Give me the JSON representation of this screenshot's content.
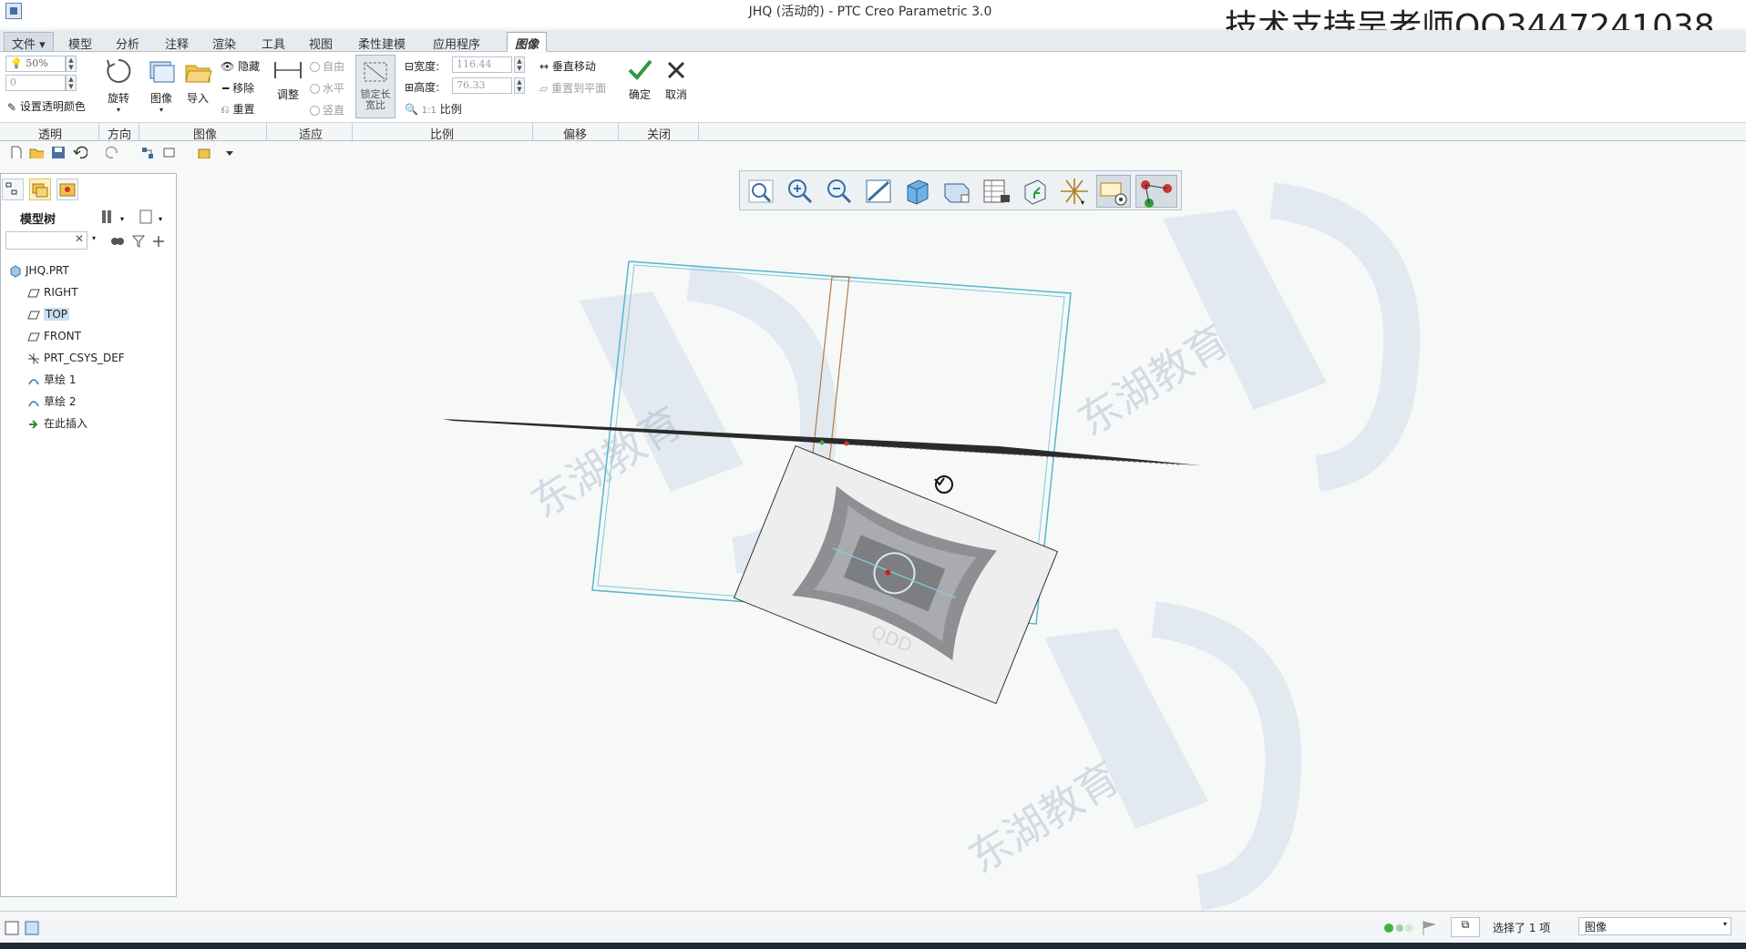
{
  "window": {
    "title": "JHQ (活动的) - PTC Creo Parametric 3.0",
    "overlay_text": "技术支持吴老师QQ3447241038"
  },
  "tabs": [
    "文件",
    "模型",
    "分析",
    "注释",
    "渲染",
    "工具",
    "视图",
    "柔性建模",
    "应用程序",
    "图像"
  ],
  "active_tab": "图像",
  "ribbon": {
    "transparency": {
      "value": "50%",
      "second_value": "0",
      "set_color_label": "设置透明颜色",
      "group_label": "透明"
    },
    "orientation": {
      "rotate_label": "旋转",
      "group_label": "方向"
    },
    "image": {
      "image_label": "图像",
      "import_label": "导入",
      "hide_label": "隐藏",
      "remove_label": "移除",
      "reset_label": "重置",
      "group_label": "图像"
    },
    "fit": {
      "adjust_label": "调整",
      "free_label": "自由",
      "horizontal_label": "水平",
      "vertical_label": "竖直",
      "lock_aspect_label": "锁定长宽比",
      "group_label": "适应"
    },
    "scale": {
      "width_label": "宽度:",
      "width_value": "116.44",
      "height_label": "高度:",
      "height_value": "76.33",
      "ratio_prefix": "1:1",
      "ratio_label": "比例",
      "group_label": "比例"
    },
    "offset": {
      "move_label": "垂直移动",
      "reset_plane_label": "重置到平面",
      "group_label": "偏移"
    },
    "close": {
      "ok_label": "确定",
      "cancel_label": "取消",
      "group_label": "关闭"
    }
  },
  "sidebar": {
    "title": "模型树",
    "items": [
      {
        "label": "JHQ.PRT",
        "icon": "part-icon"
      },
      {
        "label": "RIGHT",
        "icon": "datum-plane-icon"
      },
      {
        "label": "TOP",
        "icon": "datum-plane-icon",
        "selected": true
      },
      {
        "label": "FRONT",
        "icon": "datum-plane-icon"
      },
      {
        "label": "PRT_CSYS_DEF",
        "icon": "csys-icon"
      },
      {
        "label": "草绘 1",
        "icon": "sketch-icon"
      },
      {
        "label": "草绘 2",
        "icon": "sketch-icon"
      },
      {
        "label": "在此插入",
        "icon": "insert-arrow-icon"
      }
    ]
  },
  "watermark": {
    "text": "东湖教育"
  },
  "image_caption": "QDD",
  "status": {
    "selection_text": "选择了 1 项",
    "filter_value": "图像"
  }
}
